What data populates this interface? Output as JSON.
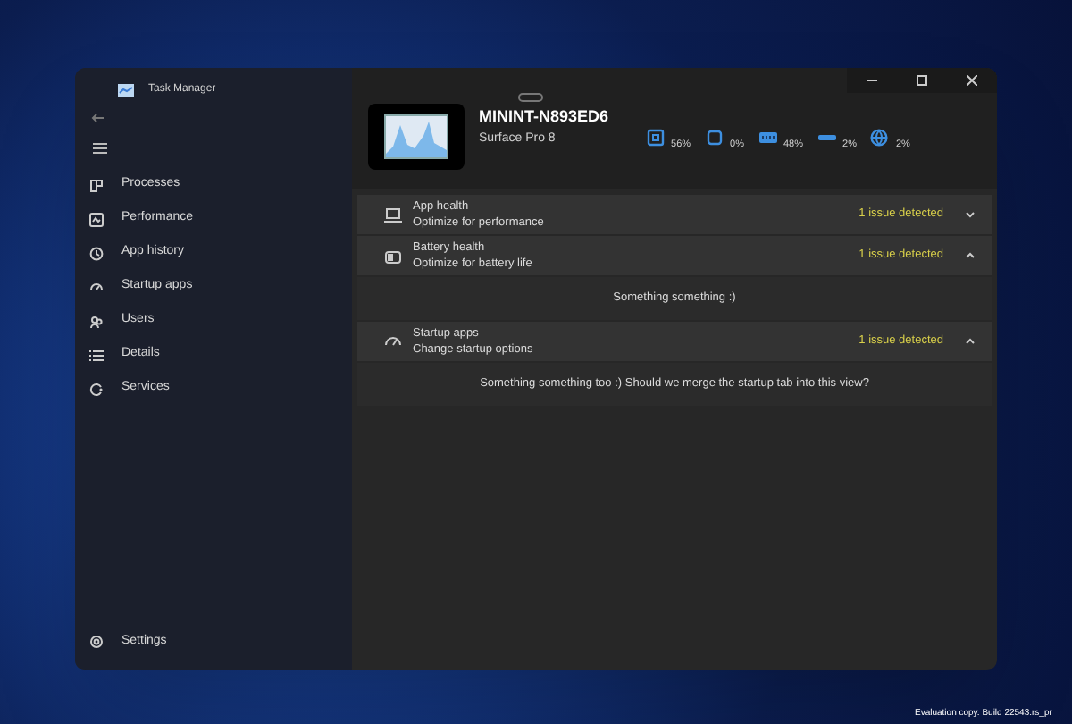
{
  "window": {
    "title": "Task Manager"
  },
  "sidebar": {
    "items": [
      {
        "label": "Processes",
        "kind": "processes",
        "selected": false
      },
      {
        "label": "Performance",
        "kind": "performance",
        "selected": false
      },
      {
        "label": "App history",
        "kind": "history",
        "selected": false
      },
      {
        "label": "Startup apps",
        "kind": "startup",
        "selected": false
      },
      {
        "label": "Users",
        "kind": "users",
        "selected": false
      },
      {
        "label": "Details",
        "kind": "details",
        "selected": false
      },
      {
        "label": "Services",
        "kind": "services",
        "selected": false
      }
    ],
    "settings": {
      "label": "Settings"
    }
  },
  "device": {
    "name": "MININT-N893ED6",
    "model": "Surface Pro 8"
  },
  "stats": [
    {
      "kind": "cpu",
      "value": "56%"
    },
    {
      "kind": "gpu",
      "value": "0%"
    },
    {
      "kind": "memory",
      "value": "48%"
    },
    {
      "kind": "disk",
      "value": "2%"
    },
    {
      "kind": "network",
      "value": "2%"
    }
  ],
  "sections": [
    {
      "kind": "app",
      "title": "App health",
      "subtitle": "Optimize for performance",
      "status": "1 issue detected",
      "expanded": false
    },
    {
      "kind": "battery",
      "title": "Battery health",
      "subtitle": "Optimize for battery life",
      "status": "1 issue detected",
      "expanded": true,
      "body": "Something something :)"
    },
    {
      "kind": "startup",
      "title": "Startup apps",
      "subtitle": "Change startup options",
      "status": "1 issue detected",
      "expanded": true,
      "body": "Something something too :) Should we merge the startup tab into this view?"
    }
  ],
  "desktop_text": "Evaluation copy. Build 22543.rs_pr"
}
